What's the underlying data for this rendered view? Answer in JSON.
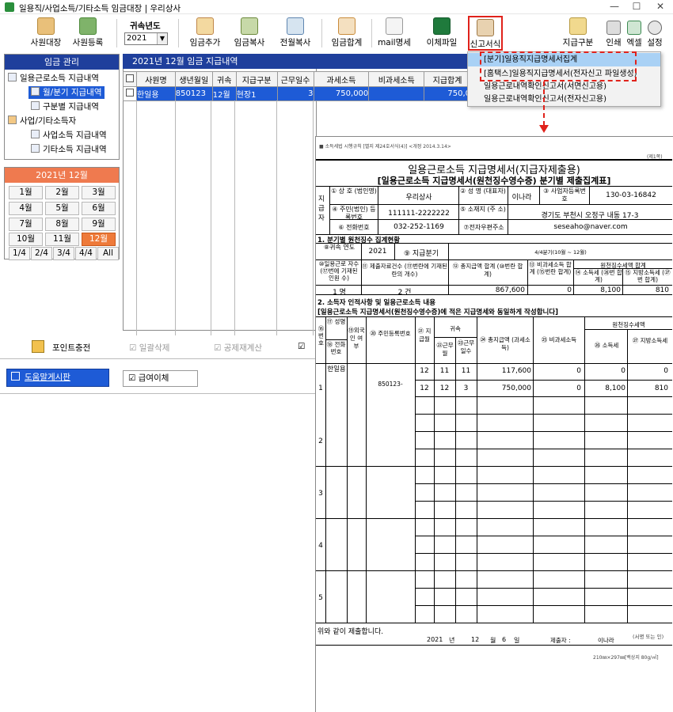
{
  "window": {
    "title": "일용직/사업소득/기타소득 임금대장 | 우리상사",
    "controls": [
      "—",
      "☐",
      "✕"
    ]
  },
  "toolbar": {
    "employee_ledger": "사원대장",
    "employee_register": "사원등록",
    "year_label": "귀속년도",
    "year_value": "2021",
    "add_wage": "임금추가",
    "copy_wage": "임금복사",
    "copy_prev_month": "전월복사",
    "wage_total": "임금합계",
    "mail_statement": "mail명세",
    "transfer_file": "이체파일",
    "report_forms": "신고서식",
    "payment_category": "지급구분",
    "print": "인쇄",
    "excel": "엑셀",
    "settings": "설정"
  },
  "sidebar": {
    "header": "임금 관리",
    "tree": [
      {
        "label": "일용근로소득 지급내역"
      },
      {
        "label": "월/분기 지급내역"
      },
      {
        "label": "구분별 지급내역"
      },
      {
        "label": "사업/기타소득자"
      },
      {
        "label": "사업소득 지급내역"
      },
      {
        "label": "기타소득 지급내역"
      }
    ],
    "month_header": "2021년 12월",
    "months": [
      "1월",
      "2월",
      "3월",
      "4월",
      "5월",
      "6월",
      "7월",
      "8월",
      "9월",
      "10월",
      "11월",
      "12월"
    ],
    "quarters": [
      "1/4",
      "2/4",
      "3/4",
      "4/4",
      "All"
    ],
    "point_charge": "포인트충전",
    "help_board": "도움말게시판"
  },
  "grid": {
    "title": "2021년 12월 임금 지급내역",
    "columns": [
      "",
      "사원명",
      "생년월일",
      "귀속",
      "지급구분",
      "근무일수",
      "과세소득",
      "비과세소득",
      "지급합계"
    ],
    "rows": [
      [
        "",
        "한일용",
        "850123",
        "12월",
        "현장1",
        "3",
        "750,000",
        "",
        "750,0"
      ]
    ],
    "options": {
      "bulk_delete": "일괄삭제",
      "deduction_recalc": "공제재계산",
      "salary_transfer": "급여이체"
    }
  },
  "dropdown": {
    "items": [
      "[분기]일용직지급명세서집계",
      "[홈택스]일용직지급명세서(전자신고 파일생성)",
      "일용근로내역확인신고서(서면신고용)",
      "일용근로내역확인신고서(전자신고용)"
    ]
  },
  "document": {
    "top_note": "■ 소득세법 시행규칙 [별지 제24호서식(4)] <개정 2014.3.14>",
    "page_note": "(제1쪽)",
    "title1": "일용근로소득 지급명세서(지급자제출용)",
    "title2": "[일용근로소득 지급명세서(원천징수영수증) 분기별 제출집계표]",
    "payer_label": "지급자",
    "f1_label": "① 상 호 (법인명)",
    "f1_value": "우리상사",
    "f2_label": "② 성 명 (대표자)",
    "f2_value": "이나라",
    "f3_label": "③ 사업자등록번호",
    "f3_value": "130-03-16842",
    "f4_label": "④ 주민(법인) 등록번호",
    "f4_value": "111111-2222222",
    "f5_label": "⑤ 소재지 (주 소)",
    "f5_value": "경기도 부천시 오정구 내동 17-3",
    "f6_label": "⑥ 전화번호",
    "f6_value": "032-252-1169",
    "f7_label": "⑦전자우편주소",
    "f7_value": "seseaho@naver.com",
    "sec1": "1. 분기별 원천징수 집계현황",
    "year_label": "⑧귀속 연도",
    "year_value": "2021",
    "quarter_label": "⑨ 지급분기",
    "quarter_value": "4/4분기(10월 ~ 12월)",
    "s_h1": "⑩일용근로 자수(⑰번에 기재된 인원 수)",
    "s_h2": "⑪ 제출자료건수 (⑰번란에 기재된 란의 개수)",
    "s_h3": "⑫ 총지급액 합계 (⑩번란 합계)",
    "s_h4": "⑬ 비과세소득 합계 (⑮번란 합계)",
    "s_h5": "원천징수세액 합계",
    "s_h6": "⑭ 소득세 (㉖번 합계)",
    "s_h7": "⑮ 지방소득세 (㉗번 합계)",
    "s_v1": "1 명",
    "s_v2": "2 건",
    "s_v3": "867,600",
    "s_v4": "0",
    "s_v5": "8,100",
    "s_v6": "810",
    "sec2": "2. 소득자 인적사항 및 일용근로소득 내용",
    "sec2b": "[일용근로소득 지급명세서(원천징수영수증)에 적은 지급명세와 동일하게 작성합니다]",
    "d_h0": "⑯ 번호",
    "d_h1": "⑰ 성명",
    "d_h1b": "⑱ 전화번호",
    "d_h2": "⑲외국인 여부",
    "d_h3": "⑳ 주민등록번호",
    "d_h4": "㉑ 지급월",
    "d_h5": "귀속",
    "d_h5a": "㉒근무월",
    "d_h5b": "㉓근무일수",
    "d_h6": "㉔ 총지급액 (과세소득)",
    "d_h7": "㉕ 비과세소득",
    "d_h8": "원천징수세액",
    "d_h9": "㉖ 소득세",
    "d_h10": "㉗ 지방소득세",
    "row_nums": [
      "1",
      "2",
      "3",
      "4",
      "5"
    ],
    "person_name": "한일용",
    "person_ssn": "850123-",
    "r1": [
      "11",
      "11",
      "12",
      "117,600",
      "0",
      "0",
      "0"
    ],
    "r2": [
      "12",
      "12",
      "3",
      "750,000",
      "0",
      "8,100",
      "810"
    ],
    "submit_text": "위와 같이 제출합니다.",
    "sign_year": "2021",
    "sign_year_unit": "년",
    "sign_month": "12",
    "sign_month_unit": "월",
    "sign_day": "6",
    "sign_day_unit": "일",
    "submitter_label": "제출자 :",
    "submitter_name": "이나라",
    "sign_note": "(서명 또는 인)",
    "paper_note": "210㎜×297㎜[백상지 80g/㎡]"
  }
}
